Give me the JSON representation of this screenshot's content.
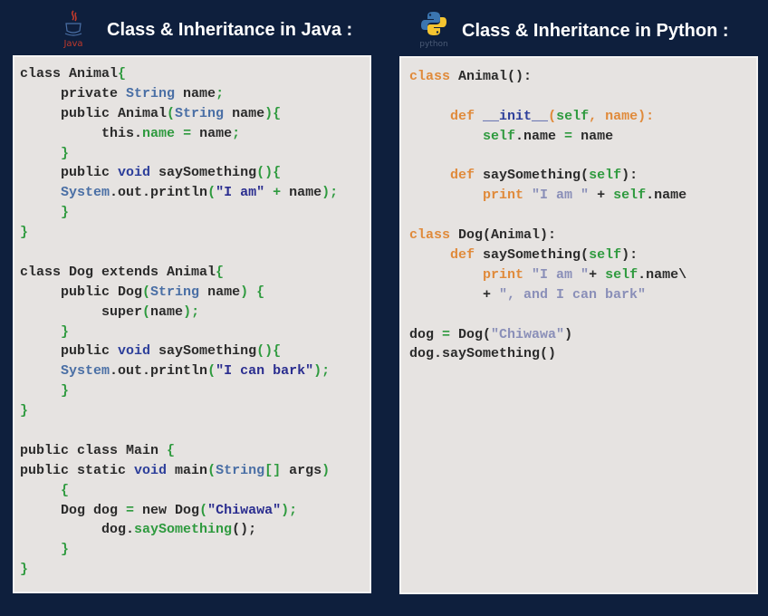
{
  "java": {
    "title": "Class & Inheritance in Java :",
    "logo_label": "Java",
    "logo_icon": "java-coffee-cup-icon",
    "code_lines": [
      [
        {
          "t": "class Animal",
          "c": ""
        },
        {
          "t": "{",
          "c": "grn"
        }
      ],
      [
        {
          "t": "     private ",
          "c": ""
        },
        {
          "t": "String",
          "c": "type-blue"
        },
        {
          "t": " name",
          "c": ""
        },
        {
          "t": ";",
          "c": "grn"
        }
      ],
      [
        {
          "t": "     public Animal",
          "c": ""
        },
        {
          "t": "(",
          "c": "grn"
        },
        {
          "t": "String",
          "c": "type-blue"
        },
        {
          "t": " name",
          "c": ""
        },
        {
          "t": "){",
          "c": "grn"
        }
      ],
      [
        {
          "t": "          this.",
          "c": ""
        },
        {
          "t": "name",
          "c": "grn"
        },
        {
          "t": " ",
          "c": ""
        },
        {
          "t": "=",
          "c": "grn"
        },
        {
          "t": " name",
          "c": ""
        },
        {
          "t": ";",
          "c": "grn"
        }
      ],
      [
        {
          "t": "     ",
          "c": ""
        },
        {
          "t": "}",
          "c": "grn"
        }
      ],
      [
        {
          "t": "     public ",
          "c": ""
        },
        {
          "t": "void",
          "c": "kw-blue"
        },
        {
          "t": " saySomething",
          "c": ""
        },
        {
          "t": "(){",
          "c": "grn"
        }
      ],
      [
        {
          "t": "     ",
          "c": ""
        },
        {
          "t": "System",
          "c": "type-blue"
        },
        {
          "t": ".out.println",
          "c": ""
        },
        {
          "t": "(",
          "c": "grn"
        },
        {
          "t": "\"I am\"",
          "c": "str-blue"
        },
        {
          "t": " ",
          "c": ""
        },
        {
          "t": "+",
          "c": "grn"
        },
        {
          "t": " name",
          "c": ""
        },
        {
          "t": ");",
          "c": "grn"
        }
      ],
      [
        {
          "t": "     ",
          "c": ""
        },
        {
          "t": "}",
          "c": "grn"
        }
      ],
      [
        {
          "t": "}",
          "c": "grn"
        }
      ],
      [
        {
          "t": "",
          "c": ""
        }
      ],
      [
        {
          "t": "class Dog extends Animal",
          "c": ""
        },
        {
          "t": "{",
          "c": "grn"
        }
      ],
      [
        {
          "t": "     public Dog",
          "c": ""
        },
        {
          "t": "(",
          "c": "grn"
        },
        {
          "t": "String",
          "c": "type-blue"
        },
        {
          "t": " name",
          "c": ""
        },
        {
          "t": ")",
          "c": "grn"
        },
        {
          "t": " ",
          "c": ""
        },
        {
          "t": "{",
          "c": "grn"
        }
      ],
      [
        {
          "t": "          super",
          "c": ""
        },
        {
          "t": "(",
          "c": "grn"
        },
        {
          "t": "name",
          "c": ""
        },
        {
          "t": ");",
          "c": "grn"
        }
      ],
      [
        {
          "t": "     ",
          "c": ""
        },
        {
          "t": "}",
          "c": "grn"
        }
      ],
      [
        {
          "t": "     public ",
          "c": ""
        },
        {
          "t": "void",
          "c": "kw-blue"
        },
        {
          "t": " saySomething",
          "c": ""
        },
        {
          "t": "(){",
          "c": "grn"
        }
      ],
      [
        {
          "t": "     ",
          "c": ""
        },
        {
          "t": "System",
          "c": "type-blue"
        },
        {
          "t": ".out.println",
          "c": ""
        },
        {
          "t": "(",
          "c": "grn"
        },
        {
          "t": "\"I can bark\"",
          "c": "str-blue"
        },
        {
          "t": ");",
          "c": "grn"
        }
      ],
      [
        {
          "t": "     ",
          "c": ""
        },
        {
          "t": "}",
          "c": "grn"
        }
      ],
      [
        {
          "t": "}",
          "c": "grn"
        }
      ],
      [
        {
          "t": "",
          "c": ""
        }
      ],
      [
        {
          "t": "public class Main ",
          "c": ""
        },
        {
          "t": "{",
          "c": "grn"
        }
      ],
      [
        {
          "t": "public static ",
          "c": ""
        },
        {
          "t": "void",
          "c": "kw-blue"
        },
        {
          "t": " main",
          "c": ""
        },
        {
          "t": "(",
          "c": "grn"
        },
        {
          "t": "String",
          "c": "type-blue"
        },
        {
          "t": "[]",
          "c": "grn"
        },
        {
          "t": " args",
          "c": ""
        },
        {
          "t": ")",
          "c": "grn"
        }
      ],
      [
        {
          "t": "     ",
          "c": ""
        },
        {
          "t": "{",
          "c": "grn"
        }
      ],
      [
        {
          "t": "     Dog dog ",
          "c": ""
        },
        {
          "t": "=",
          "c": "grn"
        },
        {
          "t": " new Dog",
          "c": ""
        },
        {
          "t": "(",
          "c": "grn"
        },
        {
          "t": "\"Chiwawa\"",
          "c": "str-blue"
        },
        {
          "t": ");",
          "c": "grn"
        }
      ],
      [
        {
          "t": "          dog.",
          "c": ""
        },
        {
          "t": "saySomething",
          "c": "grn"
        },
        {
          "t": "();",
          "c": ""
        }
      ],
      [
        {
          "t": "     ",
          "c": ""
        },
        {
          "t": "}",
          "c": "grn"
        }
      ],
      [
        {
          "t": "}",
          "c": "grn"
        }
      ]
    ]
  },
  "python": {
    "title": "Class & Inheritance in Python :",
    "logo_label": "python",
    "logo_icon": "python-snakes-icon",
    "code_lines": [
      [
        {
          "t": "class",
          "c": "py-kw"
        },
        {
          "t": " Animal():",
          "c": ""
        }
      ],
      [
        {
          "t": "",
          "c": ""
        }
      ],
      [
        {
          "t": "     ",
          "c": ""
        },
        {
          "t": "def",
          "c": "py-kw"
        },
        {
          "t": " ",
          "c": ""
        },
        {
          "t": "__init__",
          "c": "py-dunder"
        },
        {
          "t": "(",
          "c": "py-kw"
        },
        {
          "t": "self",
          "c": "py-self"
        },
        {
          "t": ",",
          "c": "py-kw"
        },
        {
          "t": " ",
          "c": ""
        },
        {
          "t": "name",
          "c": "py-kw"
        },
        {
          "t": "):",
          "c": "py-kw"
        }
      ],
      [
        {
          "t": "         ",
          "c": ""
        },
        {
          "t": "self",
          "c": "py-self"
        },
        {
          "t": ".name ",
          "c": ""
        },
        {
          "t": "=",
          "c": "grn"
        },
        {
          "t": " name",
          "c": ""
        }
      ],
      [
        {
          "t": "",
          "c": ""
        }
      ],
      [
        {
          "t": "     ",
          "c": ""
        },
        {
          "t": "def",
          "c": "py-kw"
        },
        {
          "t": " saySomething(",
          "c": ""
        },
        {
          "t": "self",
          "c": "py-self"
        },
        {
          "t": "):",
          "c": ""
        }
      ],
      [
        {
          "t": "         ",
          "c": ""
        },
        {
          "t": "print",
          "c": "py-kw"
        },
        {
          "t": " ",
          "c": ""
        },
        {
          "t": "\"I am \"",
          "c": "py-str"
        },
        {
          "t": " + ",
          "c": ""
        },
        {
          "t": "self",
          "c": "py-self"
        },
        {
          "t": ".name",
          "c": ""
        }
      ],
      [
        {
          "t": "",
          "c": ""
        }
      ],
      [
        {
          "t": "class",
          "c": "py-kw"
        },
        {
          "t": " Dog(Animal):",
          "c": ""
        }
      ],
      [
        {
          "t": "     ",
          "c": ""
        },
        {
          "t": "def",
          "c": "py-kw"
        },
        {
          "t": " saySomething(",
          "c": ""
        },
        {
          "t": "self",
          "c": "py-self"
        },
        {
          "t": "):",
          "c": ""
        }
      ],
      [
        {
          "t": "         ",
          "c": ""
        },
        {
          "t": "print",
          "c": "py-kw"
        },
        {
          "t": " ",
          "c": ""
        },
        {
          "t": "\"I am \"",
          "c": "py-str"
        },
        {
          "t": "+ ",
          "c": ""
        },
        {
          "t": "self",
          "c": "py-self"
        },
        {
          "t": ".name\\",
          "c": ""
        }
      ],
      [
        {
          "t": "         + ",
          "c": ""
        },
        {
          "t": "\", and I can bark\"",
          "c": "py-str"
        }
      ],
      [
        {
          "t": "",
          "c": ""
        }
      ],
      [
        {
          "t": "dog ",
          "c": ""
        },
        {
          "t": "=",
          "c": "grn"
        },
        {
          "t": " Dog(",
          "c": ""
        },
        {
          "t": "\"Chiwawa\"",
          "c": "py-str"
        },
        {
          "t": ")",
          "c": ""
        }
      ],
      [
        {
          "t": "dog.saySomething()",
          "c": ""
        }
      ]
    ]
  },
  "colors": {
    "background": "#0e1f3d",
    "panel": "#e6e3e1",
    "code_default": "#2b2b2b",
    "java_green": "#2e9a3e",
    "java_type_blue": "#4a6fa5",
    "java_keyword_blue": "#2c3e9a",
    "python_keyword_orange": "#e08a3a",
    "python_string_lavender": "#8a8fb8"
  }
}
